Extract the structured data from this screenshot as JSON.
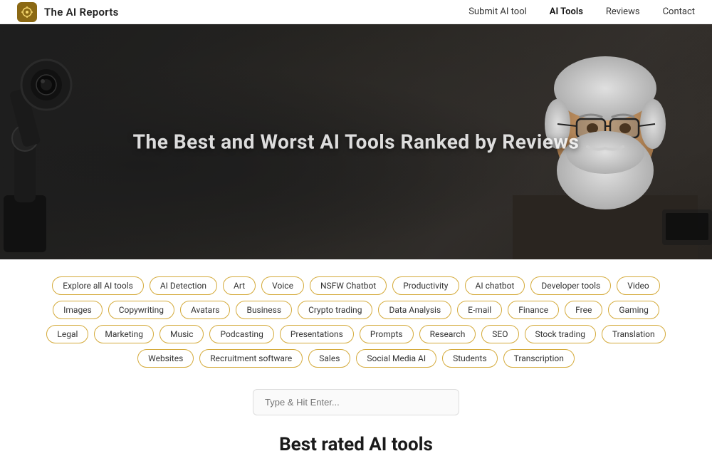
{
  "brand": {
    "logo_symbol": "⚙",
    "title": "The AI Reports"
  },
  "navbar": {
    "links": [
      {
        "id": "submit-ai-tool",
        "label": "Submit AI tool",
        "active": false
      },
      {
        "id": "ai-tools",
        "label": "AI Tools",
        "active": true
      },
      {
        "id": "reviews",
        "label": "Reviews",
        "active": false
      },
      {
        "id": "contact",
        "label": "Contact",
        "active": false
      }
    ]
  },
  "hero": {
    "title": "The Best and Worst AI Tools Ranked by Reviews"
  },
  "filters": {
    "tags": [
      "Explore all AI tools",
      "AI Detection",
      "Art",
      "Voice",
      "NSFW Chatbot",
      "Productivity",
      "AI chatbot",
      "Developer tools",
      "Video",
      "Images",
      "Copywriting",
      "Avatars",
      "Business",
      "Crypto trading",
      "Data Analysis",
      "E-mail",
      "Finance",
      "Free",
      "Gaming",
      "Legal",
      "Marketing",
      "Music",
      "Podcasting",
      "Presentations",
      "Prompts",
      "Research",
      "SEO",
      "Stock trading",
      "Translation",
      "Websites",
      "Recruitment software",
      "Sales",
      "Social Media AI",
      "Students",
      "Transcription"
    ]
  },
  "search": {
    "placeholder": "Type & Hit Enter..."
  },
  "best_rated": {
    "title": "Best rated AI tools"
  }
}
